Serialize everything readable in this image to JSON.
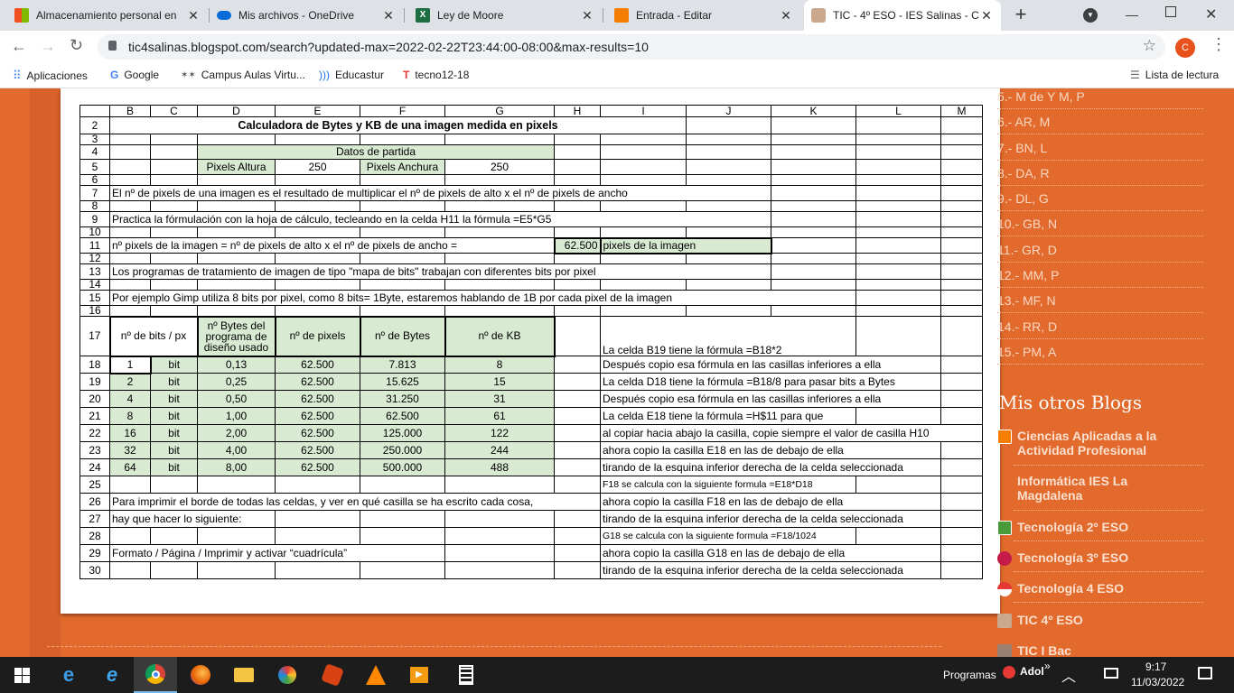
{
  "tabs": [
    {
      "title": "Almacenamiento personal en",
      "icon": "windows-logo-icon"
    },
    {
      "title": "Mis archivos - OneDrive",
      "icon": "onedrive-cloud-icon"
    },
    {
      "title": "Ley de Moore",
      "icon": "excel-icon"
    },
    {
      "title": "Entrada - Editar",
      "icon": "blogger-icon"
    },
    {
      "title": "TIC - 4º ESO - IES Salinas - Ca",
      "icon": "avatar-icon"
    }
  ],
  "url": "tic4salinas.blogspot.com/search?updated-max=2022-02-22T23:44:00-08:00&max-results=10",
  "profile_initial": "C",
  "bookmarks": {
    "apps": "Aplicaciones",
    "google": "Google",
    "campus": "Campus Aulas Virtu...",
    "educastur": "Educastur",
    "tecno": "tecno12-18",
    "reading": "Lista de lectura"
  },
  "sheet": {
    "columns": [
      "B",
      "C",
      "D",
      "E",
      "F",
      "G",
      "H",
      "I",
      "J",
      "K",
      "L",
      "M"
    ],
    "title": "Calculadora de Bytes y KB de una imagen medida en pixels",
    "datos_partida": "Datos de partida",
    "pixels_altura_label": "Pixels Altura",
    "pixels_altura": "250",
    "pixels_anchura_label": "Pixels Anchura",
    "pixels_anchura": "250",
    "r7": "El nº de pixels de una imagen es el resultado de multiplicar el nº de pixels de alto x el nº de pixels de ancho",
    "r9": "Practica la fórmulación con la hoja de cálculo, tecleando en la celda H11 la fórmula   =E5*G5",
    "r11": "nº pixels de la imagen  =  nº de pixels de alto   x   el nº de pixels de ancho   =",
    "r11_value": "62.500",
    "r11_suffix": "pixels de la imagen",
    "r13": "Los programas de tratamiento de imagen de tipo \"mapa de bits\" trabajan con diferentes bits por pixel",
    "r15": "Por ejemplo Gimp utiliza 8 bits por pixel, como 8 bits= 1Byte, estaremos hablando de 1B por cada pixel de la imagen",
    "headers": {
      "bits": "nº de bits / px",
      "bytes_programa": "nº Bytes del programa de diseño usado",
      "pixels": "nº de pixels",
      "bytes": "nº de Bytes",
      "kb": "nº de KB"
    },
    "r17_note": "La celda B19 tiene la fórmula =B18*2",
    "rows": [
      {
        "n": "18",
        "bits": "1",
        "unit": "bit",
        "bpp": "0,13",
        "px": "62.500",
        "bytes": "7.813",
        "kb": "8",
        "note": "Después copio esa fórmula en las casillas inferiores a ella"
      },
      {
        "n": "19",
        "bits": "2",
        "unit": "bit",
        "bpp": "0,25",
        "px": "62.500",
        "bytes": "15.625",
        "kb": "15",
        "note": "La celda D18 tiene la fórmula =B18/8 para pasar bits a Bytes"
      },
      {
        "n": "20",
        "bits": "4",
        "unit": "bit",
        "bpp": "0,50",
        "px": "62.500",
        "bytes": "31.250",
        "kb": "31",
        "note": "Después copio esa fórmula en las casillas inferiores a ella"
      },
      {
        "n": "21",
        "bits": "8",
        "unit": "bit",
        "bpp": "1,00",
        "px": "62.500",
        "bytes": "62.500",
        "kb": "61",
        "note": "La celda E18 tiene la fórmula  =H$11 para que"
      },
      {
        "n": "22",
        "bits": "16",
        "unit": "bit",
        "bpp": "2,00",
        "px": "62.500",
        "bytes": "125.000",
        "kb": "122",
        "note": "al copiar hacia abajo la casilla, copie siempre el valor de casilla H10"
      },
      {
        "n": "23",
        "bits": "32",
        "unit": "bit",
        "bpp": "4,00",
        "px": "62.500",
        "bytes": "250.000",
        "kb": "244",
        "note": "ahora copio la casilla E18 en las de debajo de ella"
      },
      {
        "n": "24",
        "bits": "64",
        "unit": "bit",
        "bpp": "8,00",
        "px": "62.500",
        "bytes": "500.000",
        "kb": "488",
        "note": "tirando de la esquina inferior derecha de la celda seleccionada"
      }
    ],
    "r25_note": "F18 se calcula con la siguiente formula  =E18*D18",
    "r26": "Para imprimir el borde de todas las celdas, y ver en qué casilla se ha escrito cada cosa,",
    "r26_note": "ahora copio la casilla F18 en las de debajo de ella",
    "r27": "hay que hacer lo siguiente:",
    "r27_note": "tirando de la esquina inferior derecha de la celda seleccionada",
    "r28_note": "G18 se calcula con la siguiente formula  =F18/1024",
    "r29": "Formato  /  Página /  Imprimir    y  activar  “cuadrícula”",
    "r29_note": "ahora copio la casilla G18 en las de debajo de ella",
    "r30_note": "tirando de la esquina inferior derecha de la celda seleccionada"
  },
  "sidebar": {
    "links": [
      "5.- M de Y M, P",
      "6.- AR, M",
      "7.- BN, L",
      "8.- DA, R",
      "9.- DL, G",
      "10.- GB, N",
      "11.- GR, D",
      "12.- MM, P",
      "13.- MF, N",
      "14.- RR, D",
      "15.- PM, A"
    ],
    "blogs_title": "Mis otros Blogs",
    "blogs": [
      "Ciencias Aplicadas a la Actividad Profesional",
      "Informática IES La Magdalena",
      "Tecnología 2º ESO",
      "Tecnología 3º ESO",
      "Tecnología 4 ESO",
      "TIC 4º ESO",
      "TIC I Bac"
    ]
  },
  "taskbar": {
    "programas": "Programas",
    "user": "Adol",
    "time": "9:17",
    "date": "11/03/2022"
  },
  "colors": {
    "accent": "#e26a2c",
    "cell_green": "#d9ead3",
    "tabstrip": "#dee1e6",
    "taskbar": "#1c1c1c"
  }
}
